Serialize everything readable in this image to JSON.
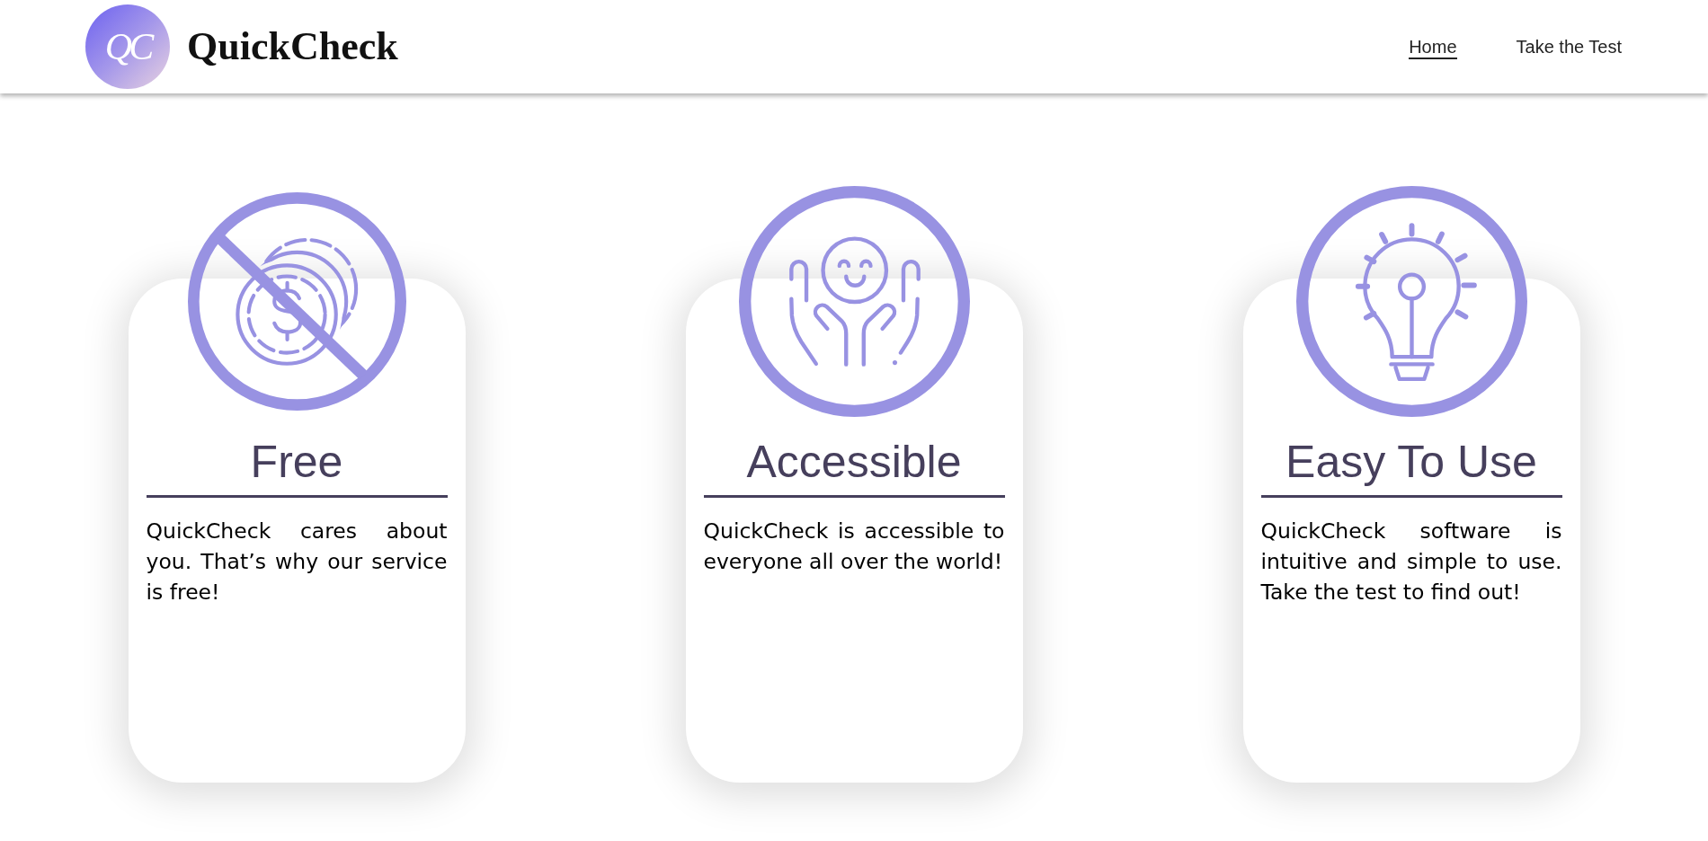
{
  "header": {
    "logo": "QC",
    "brand": "QuickCheck",
    "nav": [
      {
        "label": "Home",
        "selected": true
      },
      {
        "label": "Take the Test",
        "selected": false
      }
    ]
  },
  "features": [
    {
      "kind": "free",
      "title": "Free",
      "text": "QuickCheck cares about you. That’s why our service is free!"
    },
    {
      "kind": "accessible",
      "title": "Accessible",
      "text": "QuickCheck is accessible to everyone all over the world!"
    },
    {
      "kind": "easy",
      "title": "Easy To Use",
      "text": "QuickCheck software is intuitive and simple to use. Take the test to find out!"
    }
  ]
}
